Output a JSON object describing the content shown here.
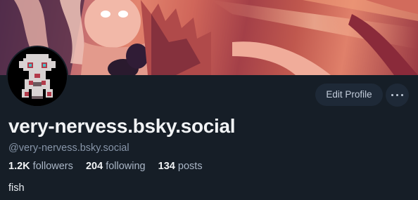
{
  "profile": {
    "display_name": "very-nervess.bsky.social",
    "handle": "@very-nervess.bsky.social",
    "bio": "fish"
  },
  "stats": {
    "followers_count": "1.2K",
    "followers_label": "followers",
    "following_count": "204",
    "following_label": "following",
    "posts_count": "134",
    "posts_label": "posts"
  },
  "actions": {
    "edit_profile_label": "Edit Profile",
    "more_icon": "ellipsis-horizontal-icon"
  },
  "colors": {
    "background": "#161e27",
    "button_bg": "#1e2937",
    "text_primary": "#f1f3f5",
    "text_secondary": "#8795a8"
  }
}
